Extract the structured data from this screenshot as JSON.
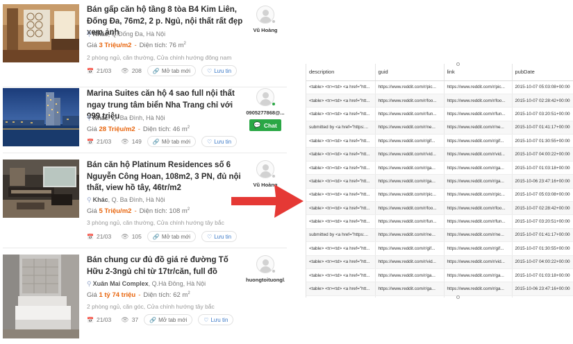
{
  "listings": [
    {
      "title": "Bán gấp căn hộ tầng 8 tòa B4 Kim Liên, Đống Đa, 76m2, 2 p. Ngủ, nội thất rất đẹp xem ảnh",
      "location_type": "Khác",
      "location": ", Q.Đống Đa, Hà Nội",
      "price_label": "Giá",
      "price": "3 Triệu/m2",
      "area_label": "Diện tích:",
      "area": "76 m",
      "area_sup": "2",
      "desc": "2 phòng ngủ, căn thường, Cửa chính hướng đông nam",
      "date": "21/03",
      "views": "208",
      "open_tab": "Mở tab mới",
      "save": "Lưu tin",
      "agent": "Vũ Hoàng",
      "has_chat": false
    },
    {
      "title": "Marina Suites căn hộ 4 sao full nội thất ngay trung tâm biển Nha Trang chỉ với 999 triệu",
      "location_type": "Khác",
      "location": ", Q. Ba Đình, Hà Nội",
      "price_label": "Giá",
      "price": "28 Triệu/m2",
      "area_label": "Diện tích:",
      "area": "46 m",
      "area_sup": "2",
      "desc": "",
      "date": "21/03",
      "views": "149",
      "open_tab": "Mở tab mới",
      "save": "Lưu tin",
      "agent": "0905277868@...",
      "has_chat": true,
      "chat_label": "Chat"
    },
    {
      "title": "Bán căn hộ Platinum Residences số 6 Nguyễn Công Hoan, 108m2, 3 PN, đủ nội thất, view hồ tây, 46tr/m2",
      "location_type": "Khác",
      "location": ", Q. Ba Đình, Hà Nội",
      "price_label": "Giá",
      "price": "5 Triệu/m2",
      "area_label": "Diện tích:",
      "area": "108 m",
      "area_sup": "2",
      "desc": "3 phòng ngủ, căn thường, Cửa chính hướng tây bắc",
      "date": "21/03",
      "views": "105",
      "open_tab": "Mở tab mới",
      "save": "Lưu tin",
      "agent": "Vũ Hoàng",
      "has_chat": false
    },
    {
      "title": "Bán chung cư đủ đồ giá rẻ đường Tố Hữu 2-3ngủ chỉ từ 17tr/căn, full đồ",
      "location_type": "Xuân Mai Complex",
      "location": ", Q.Hà Đông, Hà Nội",
      "price_label": "Giá",
      "price": "1 tỷ 74 triệu",
      "area_label": "Diện tích:",
      "area": "62 m",
      "area_sup": "2",
      "desc": "2 phòng ngủ, căn góc, Cửa chính hướng tây bắc",
      "date": "21/03",
      "views": "37",
      "open_tab": "Mở tab mới",
      "save": "Lưu tin",
      "agent": "huongtoituongl...",
      "has_chat": false
    }
  ],
  "table": {
    "headers": [
      "description",
      "guid",
      "link",
      "pubDate"
    ],
    "rows": [
      [
        "<table> <tr><td> <a href=\"htt...",
        "https://www.reddit.com/r/pic...",
        "https://www.reddit.com/r/pic...",
        "2015-10-07 05:03:08+00:00"
      ],
      [
        "<table> <tr><td> <a href=\"htt...",
        "https://www.reddit.com/r/foo...",
        "https://www.reddit.com/r/foo...",
        "2015-10-07 02:28:42+00:00"
      ],
      [
        "<table> <tr><td> <a href=\"htt...",
        "https://www.reddit.com/r/fun...",
        "https://www.reddit.com/r/fun...",
        "2015-10-07 03:20:51+00:00"
      ],
      [
        "submitted by <a href=\"https:...",
        "https://www.reddit.com/r/ne...",
        "https://www.reddit.com/r/ne...",
        "2015-10-07 01:41:17+00:00"
      ],
      [
        "<table> <tr><td> <a href=\"htt...",
        "https://www.reddit.com/r/gif...",
        "https://www.reddit.com/r/gif...",
        "2015-10-07 01:30:55+00:00"
      ],
      [
        "<table> <tr><td> <a href=\"htt...",
        "https://www.reddit.com/r/vid...",
        "https://www.reddit.com/r/vid...",
        "2015-10-07 04:00:22+00:00"
      ],
      [
        "<table> <tr><td> <a href=\"htt...",
        "https://www.reddit.com/r/ga...",
        "https://www.reddit.com/r/ga...",
        "2015-10-07 01:03:18+00:00"
      ],
      [
        "<table> <tr><td> <a href=\"htt...",
        "https://www.reddit.com/r/ga...",
        "https://www.reddit.com/r/ga...",
        "2015-10-06 23:47:16+00:00"
      ],
      [
        "<table> <tr><td> <a href=\"htt...",
        "https://www.reddit.com/r/pic...",
        "https://www.reddit.com/r/pic...",
        "2015-10-07 05:03:08+00:00"
      ],
      [
        "<table> <tr><td> <a href=\"htt...",
        "https://www.reddit.com/r/foo...",
        "https://www.reddit.com/r/foo...",
        "2015-10-07 02:28:42+00:00"
      ],
      [
        "<table> <tr><td> <a href=\"htt...",
        "https://www.reddit.com/r/fun...",
        "https://www.reddit.com/r/fun...",
        "2015-10-07 03:20:51+00:00"
      ],
      [
        "submitted by <a href=\"https:...",
        "https://www.reddit.com/r/ne...",
        "https://www.reddit.com/r/ne...",
        "2015-10-07 01:41:17+00:00"
      ],
      [
        "<table> <tr><td> <a href=\"htt...",
        "https://www.reddit.com/r/gif...",
        "https://www.reddit.com/r/gif...",
        "2015-10-07 01:30:55+00:00"
      ],
      [
        "<table> <tr><td> <a href=\"htt...",
        "https://www.reddit.com/r/vid...",
        "https://www.reddit.com/r/vid...",
        "2015-10-07 04:00:22+00:00"
      ],
      [
        "<table> <tr><td> <a href=\"htt...",
        "https://www.reddit.com/r/ga...",
        "https://www.reddit.com/r/ga...",
        "2015-10-07 01:03:18+00:00"
      ],
      [
        "<table> <tr><td> <a href=\"htt...",
        "https://www.reddit.com/r/ga...",
        "https://www.reddit.com/r/ga...",
        "2015-10-06 23:47:16+00:00"
      ],
      [
        "<table> <tr><td> <a href=\"htt...",
        "https://www.reddit.com/r/pic...",
        "https://www.reddit.com/r/pic...",
        "2015-10-07 05:03:08+00:00"
      ]
    ]
  },
  "colors": {
    "price": "#e8650d",
    "chat": "#2aa745",
    "save_link": "#3b79c7",
    "arrow": "#e53935",
    "online_dot": "#2aa745",
    "offline_dot": "#c8c8c8"
  },
  "icons": [
    "pin-icon",
    "calendar-icon",
    "eye-icon",
    "link-icon",
    "heart-icon",
    "chat-bubble-icon",
    "user-avatar-icon",
    "arrow-right-icon"
  ]
}
